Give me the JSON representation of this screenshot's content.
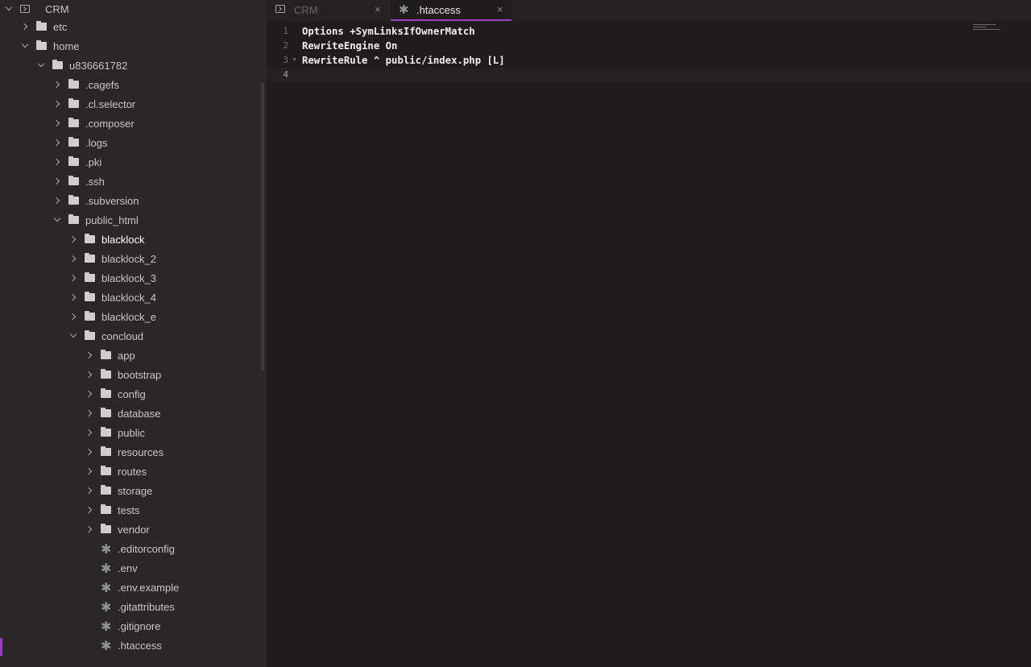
{
  "sidebar": {
    "project": "CRM",
    "items": [
      {
        "label": "etc",
        "type": "folder",
        "depth": 1,
        "expanded": false
      },
      {
        "label": "home",
        "type": "folder",
        "depth": 1,
        "expanded": true
      },
      {
        "label": "u836661782",
        "type": "folder",
        "depth": 2,
        "expanded": true
      },
      {
        "label": ".cagefs",
        "type": "folder",
        "depth": 3,
        "expanded": false
      },
      {
        "label": ".cl.selector",
        "type": "folder",
        "depth": 3,
        "expanded": false
      },
      {
        "label": ".composer",
        "type": "folder",
        "depth": 3,
        "expanded": false
      },
      {
        "label": ".logs",
        "type": "folder",
        "depth": 3,
        "expanded": false
      },
      {
        "label": ".pki",
        "type": "folder",
        "depth": 3,
        "expanded": false
      },
      {
        "label": ".ssh",
        "type": "folder",
        "depth": 3,
        "expanded": false
      },
      {
        "label": ".subversion",
        "type": "folder",
        "depth": 3,
        "expanded": false
      },
      {
        "label": "public_html",
        "type": "folder",
        "depth": 3,
        "expanded": true
      },
      {
        "label": "blacklock",
        "type": "folder",
        "depth": 4,
        "expanded": false,
        "highlight": true
      },
      {
        "label": "blacklock_2",
        "type": "folder",
        "depth": 4,
        "expanded": false
      },
      {
        "label": "blacklock_3",
        "type": "folder",
        "depth": 4,
        "expanded": false
      },
      {
        "label": "blacklock_4",
        "type": "folder",
        "depth": 4,
        "expanded": false
      },
      {
        "label": "blacklock_e",
        "type": "folder",
        "depth": 4,
        "expanded": false
      },
      {
        "label": "concloud",
        "type": "folder",
        "depth": 4,
        "expanded": true
      },
      {
        "label": "app",
        "type": "folder",
        "depth": 5,
        "expanded": false
      },
      {
        "label": "bootstrap",
        "type": "folder",
        "depth": 5,
        "expanded": false
      },
      {
        "label": "config",
        "type": "folder",
        "depth": 5,
        "expanded": false
      },
      {
        "label": "database",
        "type": "folder",
        "depth": 5,
        "expanded": false
      },
      {
        "label": "public",
        "type": "folder",
        "depth": 5,
        "expanded": false
      },
      {
        "label": "resources",
        "type": "folder",
        "depth": 5,
        "expanded": false
      },
      {
        "label": "routes",
        "type": "folder",
        "depth": 5,
        "expanded": false
      },
      {
        "label": "storage",
        "type": "folder",
        "depth": 5,
        "expanded": false
      },
      {
        "label": "tests",
        "type": "folder",
        "depth": 5,
        "expanded": false
      },
      {
        "label": "vendor",
        "type": "folder",
        "depth": 5,
        "expanded": false
      },
      {
        "label": ".editorconfig",
        "type": "file",
        "depth": 5
      },
      {
        "label": ".env",
        "type": "file",
        "depth": 5
      },
      {
        "label": ".env.example",
        "type": "file",
        "depth": 5
      },
      {
        "label": ".gitattributes",
        "type": "file",
        "depth": 5
      },
      {
        "label": ".gitignore",
        "type": "file",
        "depth": 5
      },
      {
        "label": ".htaccess",
        "type": "file",
        "depth": 5,
        "active": true
      }
    ]
  },
  "tabs": [
    {
      "title": "CRM",
      "icon": "terminal-icon",
      "close": "×",
      "active": false
    },
    {
      "title": ".htaccess",
      "icon": "asterisk-file-icon",
      "close": "×",
      "active": true
    }
  ],
  "editor": {
    "lines": [
      {
        "num": "1",
        "text": "Options +SymLinksIfOwnerMatch",
        "fold": false
      },
      {
        "num": "2",
        "text": "RewriteEngine On",
        "fold": false
      },
      {
        "num": "3",
        "text": "RewriteRule ^ public/index.php [L]",
        "fold": true
      },
      {
        "num": "4",
        "text": "",
        "fold": false
      }
    ],
    "current_line": 4
  },
  "colors": {
    "accent": "#9b3fc1",
    "sidebar_bg": "#2a2728",
    "editor_bg": "#1e1c1d",
    "tabbar_bg": "#252223"
  }
}
